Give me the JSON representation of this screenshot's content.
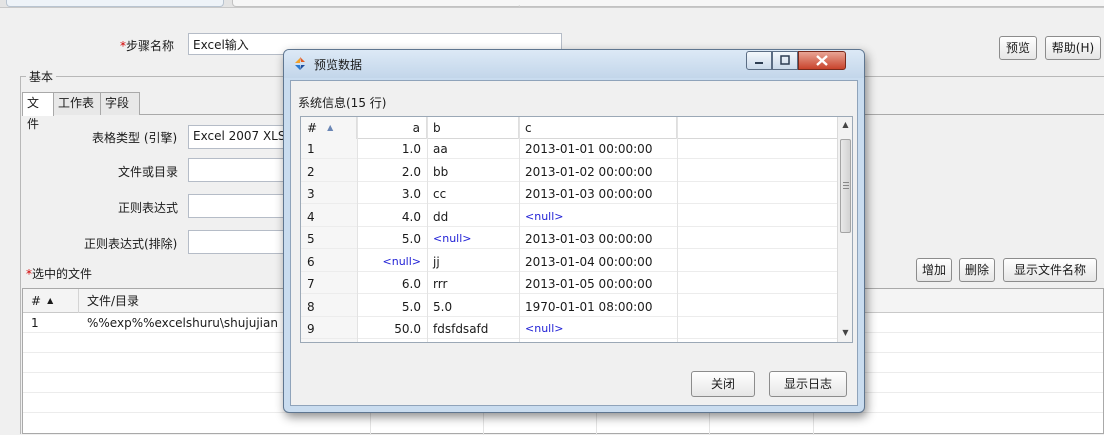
{
  "main": {
    "step_name_label": "步骤名称",
    "step_name_value": "Excel输入",
    "preview_button": "预览",
    "help_button": "帮助(H)",
    "group_label": "基本",
    "tabs": [
      {
        "label": "文件"
      },
      {
        "label": "工作表"
      },
      {
        "label": "字段"
      }
    ],
    "table_type_label": "表格类型 (引擎)",
    "table_type_value": "Excel 2007 XLS",
    "file_or_dir_label": "文件或目录",
    "regex_label": "正则表达式",
    "regex_exclude_label": "正则表达式(排除)",
    "selected_files_label": "选中的文件",
    "add_button": "增加",
    "delete_button": "删除",
    "show_filename_button": "显示文件名称",
    "files_grid": {
      "headers": [
        "#",
        "文件/目录"
      ],
      "rows": [
        {
          "num": "1",
          "path": "%%exp%%excelshuru\\shujujian"
        }
      ]
    }
  },
  "dialog": {
    "title": "预览数据",
    "system_info": "系统信息(15 行)",
    "columns": [
      "#",
      "a",
      "b",
      "c"
    ],
    "rows": [
      {
        "n": "1",
        "a": "1.0",
        "b": "aa",
        "c": "2013-01-01 00:00:00"
      },
      {
        "n": "2",
        "a": "2.0",
        "b": "bb",
        "c": "2013-01-02 00:00:00"
      },
      {
        "n": "3",
        "a": "3.0",
        "b": "cc",
        "c": "2013-01-03 00:00:00"
      },
      {
        "n": "4",
        "a": "4.0",
        "b": "dd",
        "c": "<null>"
      },
      {
        "n": "5",
        "a": "5.0",
        "b": "<null>",
        "c": "2013-01-03 00:00:00"
      },
      {
        "n": "6",
        "a": "<null>",
        "b": "jj",
        "c": "2013-01-04 00:00:00"
      },
      {
        "n": "7",
        "a": "6.0",
        "b": "rrr",
        "c": "2013-01-05 00:00:00"
      },
      {
        "n": "8",
        "a": "5.0",
        "b": "5.0",
        "c": "1970-01-01 08:00:00"
      },
      {
        "n": "9",
        "a": "50.0",
        "b": "fdsfdsafd",
        "c": "<null>"
      }
    ],
    "close_button": "关闭",
    "show_log_button": "显示日志",
    "null_color": "#2323d6"
  },
  "colors": {
    "required_marker": "#d20000",
    "dialog_frame": "#c9dcef",
    "close_button_red": "#c8432c"
  }
}
